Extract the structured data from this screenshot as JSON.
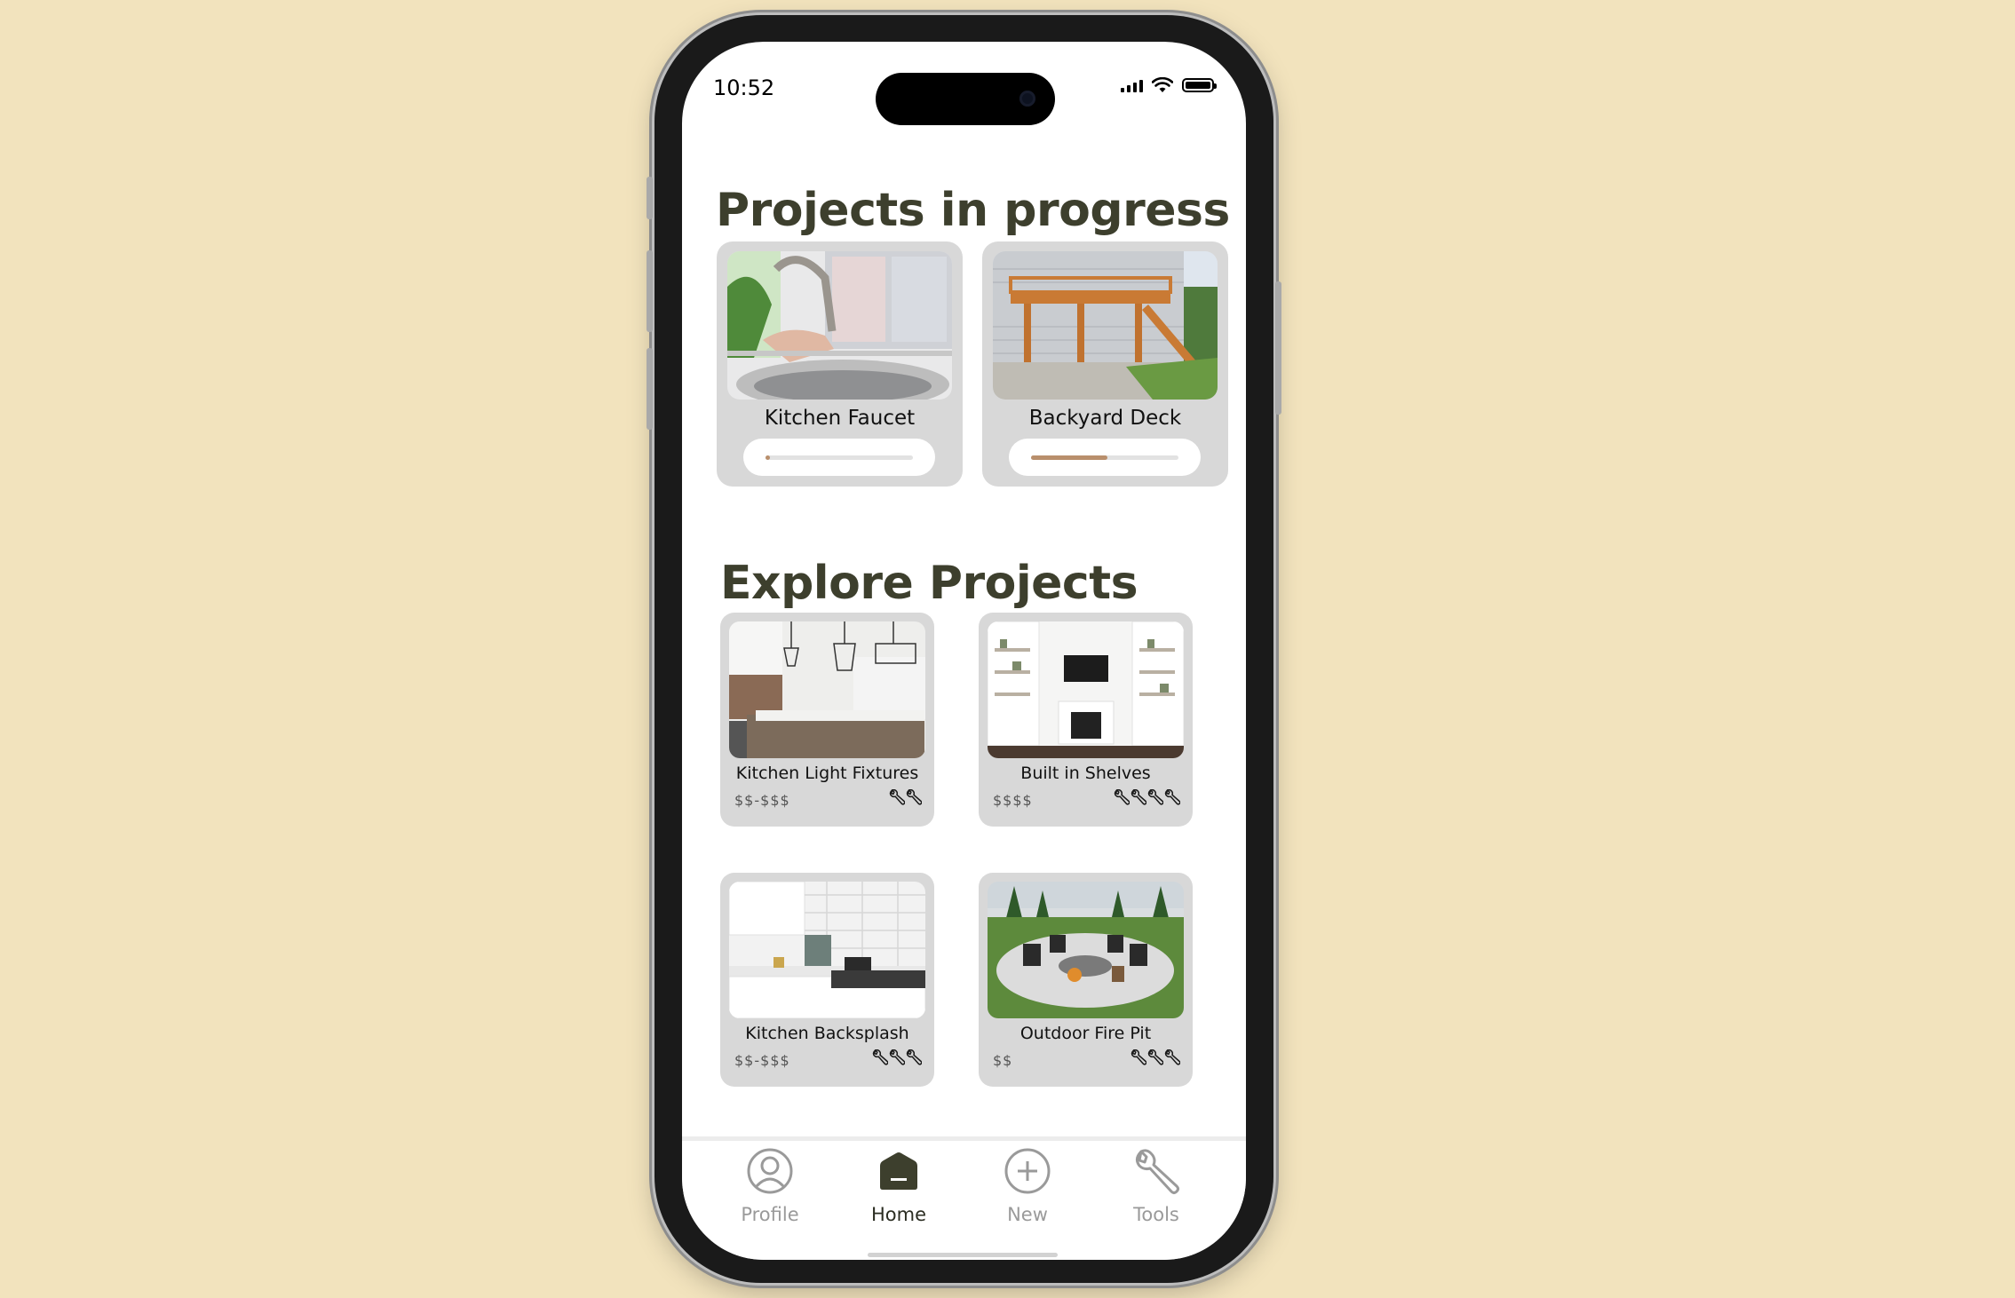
{
  "status_bar": {
    "time": "10:52"
  },
  "in_progress": {
    "heading": "Projects in progress",
    "projects": [
      {
        "title": "Kitchen Faucet",
        "progress": 0.03,
        "image": "kitchen-faucet-photo"
      },
      {
        "title": "Backyard Deck",
        "progress": 0.52,
        "image": "backyard-deck-photo"
      }
    ]
  },
  "explore": {
    "heading": "Explore Projects",
    "projects": [
      {
        "title": "Kitchen Light Fixtures",
        "price": "$$-$$$",
        "difficulty": 2,
        "image": "kitchen-light-fixtures-photo"
      },
      {
        "title": "Built in Shelves",
        "price": "$$$$",
        "difficulty": 4,
        "image": "built-in-shelves-photo"
      },
      {
        "title": "Kitchen Backsplash",
        "price": "$$-$$$",
        "difficulty": 3,
        "image": "kitchen-backsplash-photo"
      },
      {
        "title": "Outdoor Fire Pit",
        "price": "$$",
        "difficulty": 3,
        "image": "outdoor-fire-pit-photo"
      }
    ]
  },
  "tab_bar": {
    "tabs": [
      {
        "label": "Profile",
        "icon": "profile-icon",
        "active": false
      },
      {
        "label": "Home",
        "icon": "home-icon",
        "active": true
      },
      {
        "label": "New",
        "icon": "plus-circle-icon",
        "active": false
      },
      {
        "label": "Tools",
        "icon": "wrench-icon",
        "active": false
      }
    ]
  },
  "colors": {
    "background": "#f2e3bd",
    "heading": "#3d3f2d",
    "card": "#d8d8d8",
    "progress_fill": "#b98f6c",
    "tab_active": "#2b2d22",
    "tab_inactive": "#9a9a9a"
  }
}
